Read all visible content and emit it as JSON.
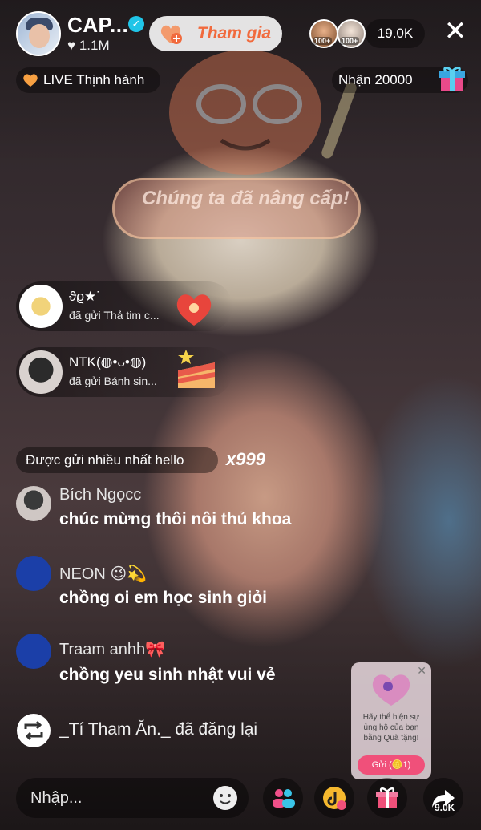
{
  "header": {
    "host_name": "CAP...",
    "likes": "♥ 1.1M",
    "follow_label": "Tham gia",
    "viewer_badges": [
      "100+",
      "100+"
    ],
    "viewer_count": "19.0K",
    "close_icon": "close-icon"
  },
  "badges": {
    "live_label": "LIVE Thịnh hành",
    "reward_label": "Nhận 20000"
  },
  "upgrade_banner": {
    "text": "Chúng ta đã nâng cấp!"
  },
  "gift_feed": [
    {
      "name": "ϑϱ★˙",
      "action": "đã gửi Thả tim c..."
    },
    {
      "name": "NTK(◍•ᴗ•◍)",
      "action": "đã gửi Bánh sin..."
    }
  ],
  "most_sent": {
    "label": "Được gửi nhiều nhất hello",
    "multiplier": "x999"
  },
  "comments": [
    {
      "name": "Bích Ngọcc",
      "text": "chúc mừng thôi nôi thủ khoa"
    },
    {
      "name": "NEON 😉💫",
      "text": "chồng oi em  học sinh giỏi"
    },
    {
      "name": "Traam anhh🎀",
      "text": "chồng yeu sinh nhật vui vẻ"
    }
  ],
  "repost": {
    "text": "_Tí Tham Ăn._ đã đăng lại"
  },
  "support_card": {
    "text": "Hãy thể hiện sự ủng hộ của bạn bằng Quà tặng!",
    "button": "Gửi (🪙1)"
  },
  "bottom_bar": {
    "input_placeholder": "Nhập...",
    "share_count": "9.0K"
  },
  "colors": {
    "follow_text": "#f16a3d",
    "verified": "#20c5e8",
    "send_button": "#f0507a"
  }
}
